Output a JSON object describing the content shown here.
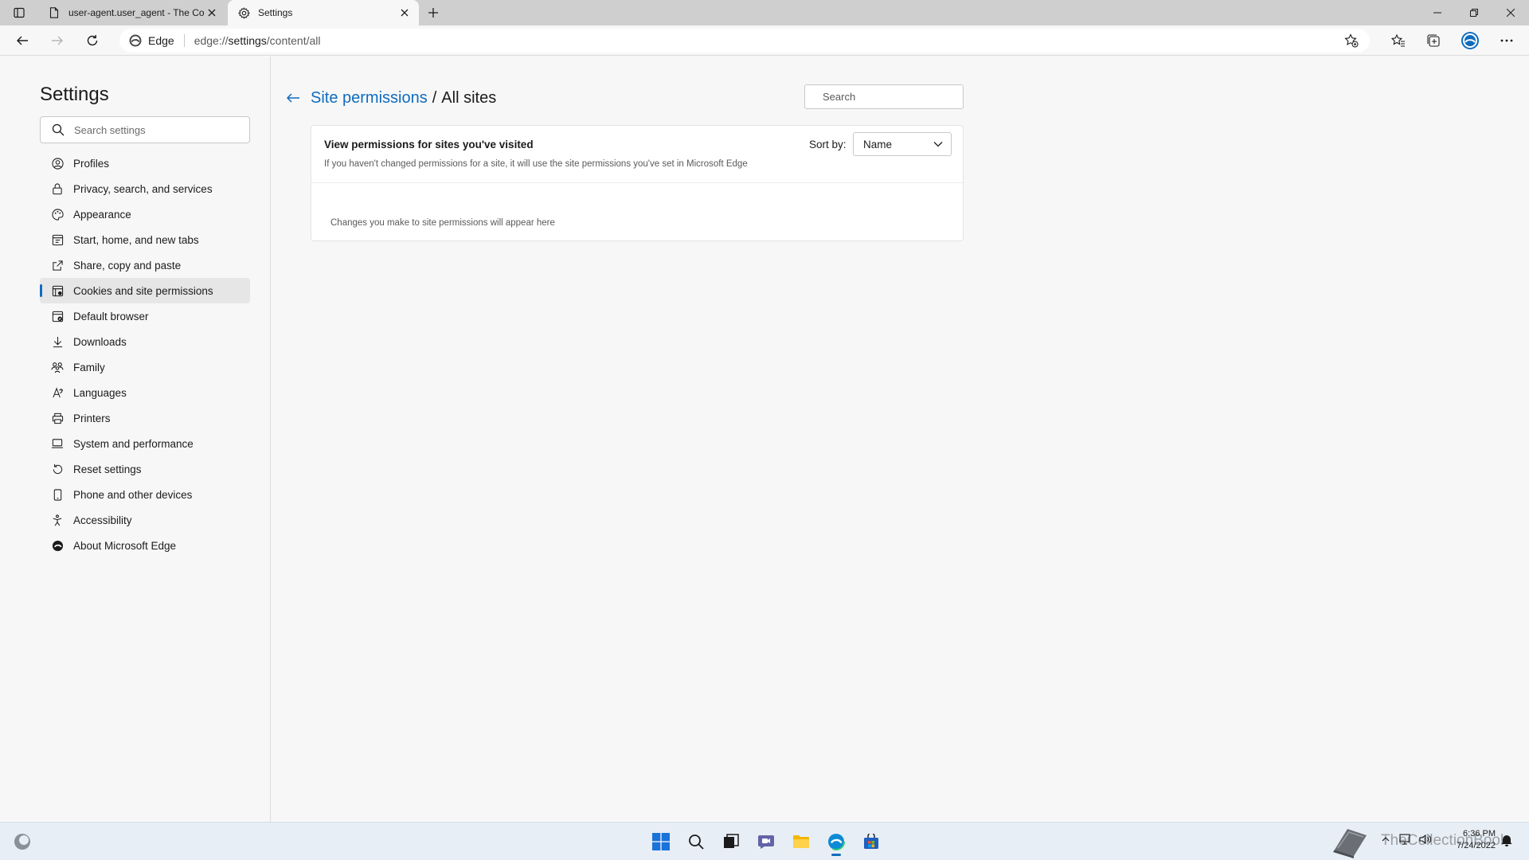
{
  "browser": {
    "tabs": [
      {
        "title": "user-agent.user_agent - The Coll",
        "icon": "document-icon",
        "active": false
      },
      {
        "title": "Settings",
        "icon": "gear-icon",
        "active": true
      }
    ],
    "address": {
      "site_label": "Edge",
      "url_prefix": "edge://",
      "url_host": "settings",
      "url_path": "/content/all"
    }
  },
  "sidebar": {
    "title": "Settings",
    "search_placeholder": "Search settings",
    "items": [
      {
        "label": "Profiles",
        "icon": "profile-icon"
      },
      {
        "label": "Privacy, search, and services",
        "icon": "lock-icon"
      },
      {
        "label": "Appearance",
        "icon": "appearance-icon"
      },
      {
        "label": "Start, home, and new tabs",
        "icon": "home-tabs-icon"
      },
      {
        "label": "Share, copy and paste",
        "icon": "share-icon"
      },
      {
        "label": "Cookies and site permissions",
        "icon": "cookies-icon",
        "active": true
      },
      {
        "label": "Default browser",
        "icon": "default-browser-icon"
      },
      {
        "label": "Downloads",
        "icon": "download-icon"
      },
      {
        "label": "Family",
        "icon": "family-icon"
      },
      {
        "label": "Languages",
        "icon": "languages-icon"
      },
      {
        "label": "Printers",
        "icon": "printer-icon"
      },
      {
        "label": "System and performance",
        "icon": "laptop-icon"
      },
      {
        "label": "Reset settings",
        "icon": "reset-icon"
      },
      {
        "label": "Phone and other devices",
        "icon": "phone-icon"
      },
      {
        "label": "Accessibility",
        "icon": "accessibility-icon"
      },
      {
        "label": "About Microsoft Edge",
        "icon": "edge-icon"
      }
    ]
  },
  "main": {
    "breadcrumb_parent": "Site permissions",
    "breadcrumb_sep": "/",
    "breadcrumb_current": "All sites",
    "search_placeholder": "Search",
    "card": {
      "title": "View permissions for sites you've visited",
      "description": "If you haven't changed permissions for a site, it will use the site permissions you've set in Microsoft Edge",
      "sort_label": "Sort by:",
      "sort_value": "Name",
      "empty_message": "Changes you make to site permissions will appear here"
    }
  },
  "taskbar": {
    "clock_time": "6:36 PM",
    "clock_date": "7/24/2022",
    "watermark": "TheCollectionBook"
  },
  "colors": {
    "accent": "#0f6cbd",
    "tabstrip": "#cfcfcf",
    "background": "#f7f7f7"
  }
}
